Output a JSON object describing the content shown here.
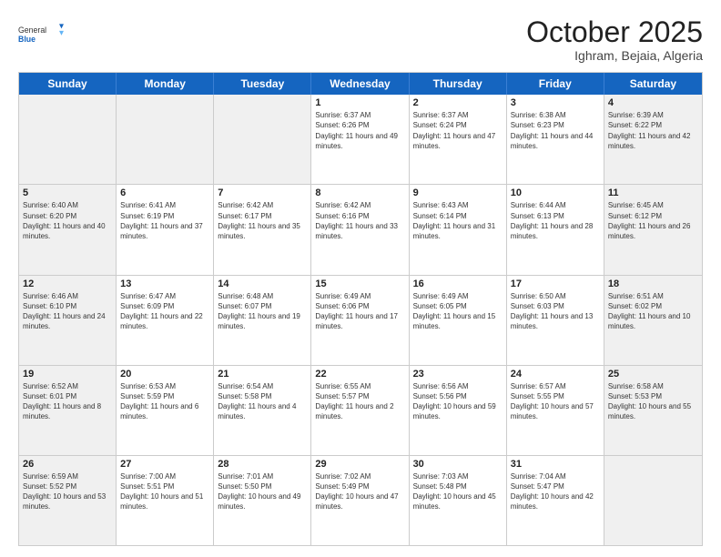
{
  "header": {
    "logo_line1": "General",
    "logo_line2": "Blue",
    "month": "October 2025",
    "location": "Ighram, Bejaia, Algeria"
  },
  "days_of_week": [
    "Sunday",
    "Monday",
    "Tuesday",
    "Wednesday",
    "Thursday",
    "Friday",
    "Saturday"
  ],
  "weeks": [
    [
      {
        "day": "",
        "info": "",
        "shaded": true
      },
      {
        "day": "",
        "info": "",
        "shaded": true
      },
      {
        "day": "",
        "info": "",
        "shaded": true
      },
      {
        "day": "1",
        "info": "Sunrise: 6:37 AM\nSunset: 6:26 PM\nDaylight: 11 hours and 49 minutes.",
        "shaded": false
      },
      {
        "day": "2",
        "info": "Sunrise: 6:37 AM\nSunset: 6:24 PM\nDaylight: 11 hours and 47 minutes.",
        "shaded": false
      },
      {
        "day": "3",
        "info": "Sunrise: 6:38 AM\nSunset: 6:23 PM\nDaylight: 11 hours and 44 minutes.",
        "shaded": false
      },
      {
        "day": "4",
        "info": "Sunrise: 6:39 AM\nSunset: 6:22 PM\nDaylight: 11 hours and 42 minutes.",
        "shaded": true
      }
    ],
    [
      {
        "day": "5",
        "info": "Sunrise: 6:40 AM\nSunset: 6:20 PM\nDaylight: 11 hours and 40 minutes.",
        "shaded": true
      },
      {
        "day": "6",
        "info": "Sunrise: 6:41 AM\nSunset: 6:19 PM\nDaylight: 11 hours and 37 minutes.",
        "shaded": false
      },
      {
        "day": "7",
        "info": "Sunrise: 6:42 AM\nSunset: 6:17 PM\nDaylight: 11 hours and 35 minutes.",
        "shaded": false
      },
      {
        "day": "8",
        "info": "Sunrise: 6:42 AM\nSunset: 6:16 PM\nDaylight: 11 hours and 33 minutes.",
        "shaded": false
      },
      {
        "day": "9",
        "info": "Sunrise: 6:43 AM\nSunset: 6:14 PM\nDaylight: 11 hours and 31 minutes.",
        "shaded": false
      },
      {
        "day": "10",
        "info": "Sunrise: 6:44 AM\nSunset: 6:13 PM\nDaylight: 11 hours and 28 minutes.",
        "shaded": false
      },
      {
        "day": "11",
        "info": "Sunrise: 6:45 AM\nSunset: 6:12 PM\nDaylight: 11 hours and 26 minutes.",
        "shaded": true
      }
    ],
    [
      {
        "day": "12",
        "info": "Sunrise: 6:46 AM\nSunset: 6:10 PM\nDaylight: 11 hours and 24 minutes.",
        "shaded": true
      },
      {
        "day": "13",
        "info": "Sunrise: 6:47 AM\nSunset: 6:09 PM\nDaylight: 11 hours and 22 minutes.",
        "shaded": false
      },
      {
        "day": "14",
        "info": "Sunrise: 6:48 AM\nSunset: 6:07 PM\nDaylight: 11 hours and 19 minutes.",
        "shaded": false
      },
      {
        "day": "15",
        "info": "Sunrise: 6:49 AM\nSunset: 6:06 PM\nDaylight: 11 hours and 17 minutes.",
        "shaded": false
      },
      {
        "day": "16",
        "info": "Sunrise: 6:49 AM\nSunset: 6:05 PM\nDaylight: 11 hours and 15 minutes.",
        "shaded": false
      },
      {
        "day": "17",
        "info": "Sunrise: 6:50 AM\nSunset: 6:03 PM\nDaylight: 11 hours and 13 minutes.",
        "shaded": false
      },
      {
        "day": "18",
        "info": "Sunrise: 6:51 AM\nSunset: 6:02 PM\nDaylight: 11 hours and 10 minutes.",
        "shaded": true
      }
    ],
    [
      {
        "day": "19",
        "info": "Sunrise: 6:52 AM\nSunset: 6:01 PM\nDaylight: 11 hours and 8 minutes.",
        "shaded": true
      },
      {
        "day": "20",
        "info": "Sunrise: 6:53 AM\nSunset: 5:59 PM\nDaylight: 11 hours and 6 minutes.",
        "shaded": false
      },
      {
        "day": "21",
        "info": "Sunrise: 6:54 AM\nSunset: 5:58 PM\nDaylight: 11 hours and 4 minutes.",
        "shaded": false
      },
      {
        "day": "22",
        "info": "Sunrise: 6:55 AM\nSunset: 5:57 PM\nDaylight: 11 hours and 2 minutes.",
        "shaded": false
      },
      {
        "day": "23",
        "info": "Sunrise: 6:56 AM\nSunset: 5:56 PM\nDaylight: 10 hours and 59 minutes.",
        "shaded": false
      },
      {
        "day": "24",
        "info": "Sunrise: 6:57 AM\nSunset: 5:55 PM\nDaylight: 10 hours and 57 minutes.",
        "shaded": false
      },
      {
        "day": "25",
        "info": "Sunrise: 6:58 AM\nSunset: 5:53 PM\nDaylight: 10 hours and 55 minutes.",
        "shaded": true
      }
    ],
    [
      {
        "day": "26",
        "info": "Sunrise: 6:59 AM\nSunset: 5:52 PM\nDaylight: 10 hours and 53 minutes.",
        "shaded": true
      },
      {
        "day": "27",
        "info": "Sunrise: 7:00 AM\nSunset: 5:51 PM\nDaylight: 10 hours and 51 minutes.",
        "shaded": false
      },
      {
        "day": "28",
        "info": "Sunrise: 7:01 AM\nSunset: 5:50 PM\nDaylight: 10 hours and 49 minutes.",
        "shaded": false
      },
      {
        "day": "29",
        "info": "Sunrise: 7:02 AM\nSunset: 5:49 PM\nDaylight: 10 hours and 47 minutes.",
        "shaded": false
      },
      {
        "day": "30",
        "info": "Sunrise: 7:03 AM\nSunset: 5:48 PM\nDaylight: 10 hours and 45 minutes.",
        "shaded": false
      },
      {
        "day": "31",
        "info": "Sunrise: 7:04 AM\nSunset: 5:47 PM\nDaylight: 10 hours and 42 minutes.",
        "shaded": false
      },
      {
        "day": "",
        "info": "",
        "shaded": true
      }
    ]
  ]
}
